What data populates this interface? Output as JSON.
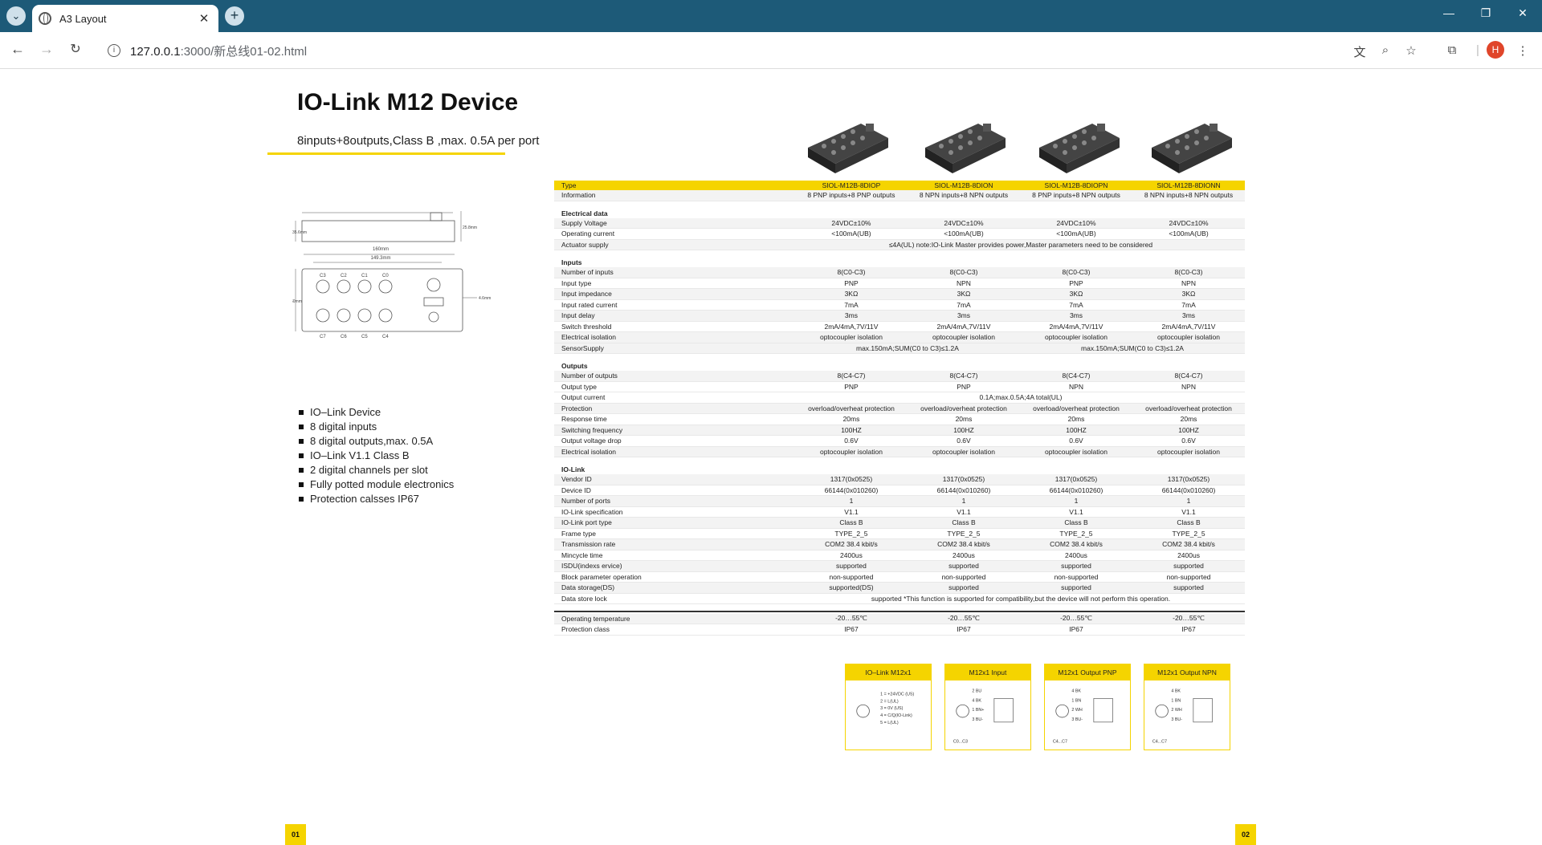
{
  "browser": {
    "tab_title": "A3 Layout",
    "url_host": "127.0.0.1",
    "url_path": ":3000/新总线01-02.html",
    "avatar_letter": "H"
  },
  "page": {
    "title": "IO-Link M12 Device",
    "subtitle": "8inputs+8outputs,Class B ,max. 0.5A per port",
    "features": [
      "IO–Link Device",
      "8 digital inputs",
      "8 digital outputs,max. 0.5A",
      "IO–Link V1.1 Class B",
      "2 digital channels per slot",
      "Fully potted module electronics",
      "Protection calsses IP67"
    ],
    "drawing": {
      "dim_top": "160mm",
      "dim_inner": "149.3mm",
      "dim_height_left": "35.6mm",
      "dim_height_right": "25.8mm",
      "dim_depth": "60mm",
      "dim_hole": "4.6mm",
      "top_ports": [
        "C3",
        "C2",
        "C1",
        "C0"
      ],
      "bottom_ports": [
        "C7",
        "C6",
        "C5",
        "C4"
      ]
    },
    "page_left": "01",
    "page_right": "02"
  },
  "spec": {
    "type_label": "Type",
    "info_label": "Information",
    "models": [
      "SIOL-M12B-8DIOP",
      "SIOL-M12B-8DION",
      "SIOL-M12B-8DIOPN",
      "SIOL-M12B-8DIONN"
    ],
    "info": [
      "8 PNP inputs+8 PNP outputs",
      "8 NPN inputs+8 NPN outputs",
      "8 PNP inputs+8 NPN outputs",
      "8 NPN inputs+8 NPN outputs"
    ],
    "electrical": {
      "title": "Electrical data",
      "supply_label": "Supply Voltage",
      "supply": "24VDC±10%",
      "current_label": "Operating current",
      "current": "<100mA(UB)",
      "actuator_label": "Actuator supply",
      "actuator": "≤4A(UL) note:IO-Link Master provides power,Master parameters need to be considered"
    },
    "inputs": {
      "title": "Inputs",
      "rows": [
        {
          "label": "Number of inputs",
          "vals": [
            "8(C0-C3)",
            "8(C0-C3)",
            "8(C0-C3)",
            "8(C0-C3)"
          ]
        },
        {
          "label": "Input type",
          "vals": [
            "PNP",
            "NPN",
            "PNP",
            "NPN"
          ]
        },
        {
          "label": "Input impedance",
          "vals": [
            "3KΩ",
            "3KΩ",
            "3KΩ",
            "3KΩ"
          ]
        },
        {
          "label": "Input rated current",
          "vals": [
            "7mA",
            "7mA",
            "7mA",
            "7mA"
          ]
        },
        {
          "label": "Input delay",
          "vals": [
            "3ms",
            "3ms",
            "3ms",
            "3ms"
          ]
        },
        {
          "label": "Switch threshold",
          "vals": [
            "2mA/4mA,7V/11V",
            "2mA/4mA,7V/11V",
            "2mA/4mA,7V/11V",
            "2mA/4mA,7V/11V"
          ]
        },
        {
          "label": "Electrical isolation",
          "vals": [
            "optocoupler isolation",
            "optocoupler isolation",
            "optocoupler isolation",
            "optocoupler isolation"
          ]
        }
      ],
      "sensor_label": "SensorSupply",
      "sensor": "max.150mA;SUM(C0 to C3)≤1.2A"
    },
    "outputs": {
      "title": "Outputs",
      "rows_a": [
        {
          "label": "Number of outputs",
          "vals": [
            "8(C4-C7)",
            "8(C4-C7)",
            "8(C4-C7)",
            "8(C4-C7)"
          ]
        },
        {
          "label": "Output type",
          "vals": [
            "PNP",
            "PNP",
            "NPN",
            "NPN"
          ]
        }
      ],
      "current_label": "Output current",
      "current": "0.1A;max.0.5A;4A total(UL)",
      "rows_b": [
        {
          "label": "Protection",
          "vals": [
            "overload/overheat protection",
            "overload/overheat protection",
            "overload/overheat protection",
            "overload/overheat protection"
          ]
        },
        {
          "label": "Response time",
          "vals": [
            "20ms",
            "20ms",
            "20ms",
            "20ms"
          ]
        },
        {
          "label": "Switching frequency",
          "vals": [
            "100HZ",
            "100HZ",
            "100HZ",
            "100HZ"
          ]
        },
        {
          "label": "Output voltage drop",
          "vals": [
            "0.6V",
            "0.6V",
            "0.6V",
            "0.6V"
          ]
        },
        {
          "label": "Electrical isolation",
          "vals": [
            "optocoupler isolation",
            "optocoupler isolation",
            "optocoupler isolation",
            "optocoupler isolation"
          ]
        }
      ]
    },
    "iolink": {
      "title": "IO-Link",
      "rows": [
        {
          "label": "Vendor ID",
          "vals": [
            "1317(0x0525)",
            "1317(0x0525)",
            "1317(0x0525)",
            "1317(0x0525)"
          ]
        },
        {
          "label": "Device ID",
          "vals": [
            "66144(0x010260)",
            "66144(0x010260)",
            "66144(0x010260)",
            "66144(0x010260)"
          ]
        },
        {
          "label": "Number of ports",
          "vals": [
            "1",
            "1",
            "1",
            "1"
          ]
        },
        {
          "label": "IO-Link specification",
          "vals": [
            "V1.1",
            "V1.1",
            "V1.1",
            "V1.1"
          ]
        },
        {
          "label": "IO-Link port type",
          "vals": [
            "Class B",
            "Class B",
            "Class B",
            "Class B"
          ]
        },
        {
          "label": "Frame type",
          "vals": [
            "TYPE_2_5",
            "TYPE_2_5",
            "TYPE_2_5",
            "TYPE_2_5"
          ]
        },
        {
          "label": "Transmission rate",
          "vals": [
            "COM2 38.4 kbit/s",
            "COM2 38.4 kbit/s",
            "COM2 38.4 kbit/s",
            "COM2 38.4 kbit/s"
          ]
        },
        {
          "label": "Mincycle time",
          "vals": [
            "2400us",
            "2400us",
            "2400us",
            "2400us"
          ]
        },
        {
          "label": "ISDU(indexs ervice)",
          "vals": [
            "supported",
            "supported",
            "supported",
            "supported"
          ]
        },
        {
          "label": "Block parameter operation",
          "vals": [
            "non-supported",
            "non-supported",
            "non-supported",
            "non-supported"
          ]
        },
        {
          "label": "Data storage(DS)",
          "vals": [
            "supported(DS)",
            "supported",
            "supported",
            "supported"
          ]
        }
      ],
      "store_label": "Data store lock",
      "store": "supported *This function is supported for compatibility,but the device will not perform this operation."
    },
    "env": [
      {
        "label": "Operating temperature",
        "vals": [
          "-20…55℃",
          "-20…55℃",
          "-20…55℃",
          "-20…55℃"
        ]
      },
      {
        "label": "Protection class",
        "vals": [
          "IP67",
          "IP67",
          "IP67",
          "IP67"
        ]
      }
    ]
  },
  "pinouts": [
    {
      "title": "IO–Link M12x1",
      "lines": [
        "1 = +24VDC (US)",
        "2 = L(UL)",
        "3 = 0V (US)",
        "4 = C/Q(IO-Link)",
        "5 = L(UL)"
      ]
    },
    {
      "title": "M12x1 Input",
      "lines": [
        "2 BU",
        "4 BK",
        "1 BN+",
        "3 BU-",
        "C0...C3"
      ]
    },
    {
      "title": "M12x1 Output PNP",
      "lines": [
        "4 BK",
        "1 BN",
        "2 WH",
        "3 BU-",
        "C4...C7"
      ]
    },
    {
      "title": "M12x1 Output NPN",
      "lines": [
        "4 BK",
        "1 BN",
        "2 WH",
        "3 BU-",
        "C4...C7"
      ]
    }
  ]
}
